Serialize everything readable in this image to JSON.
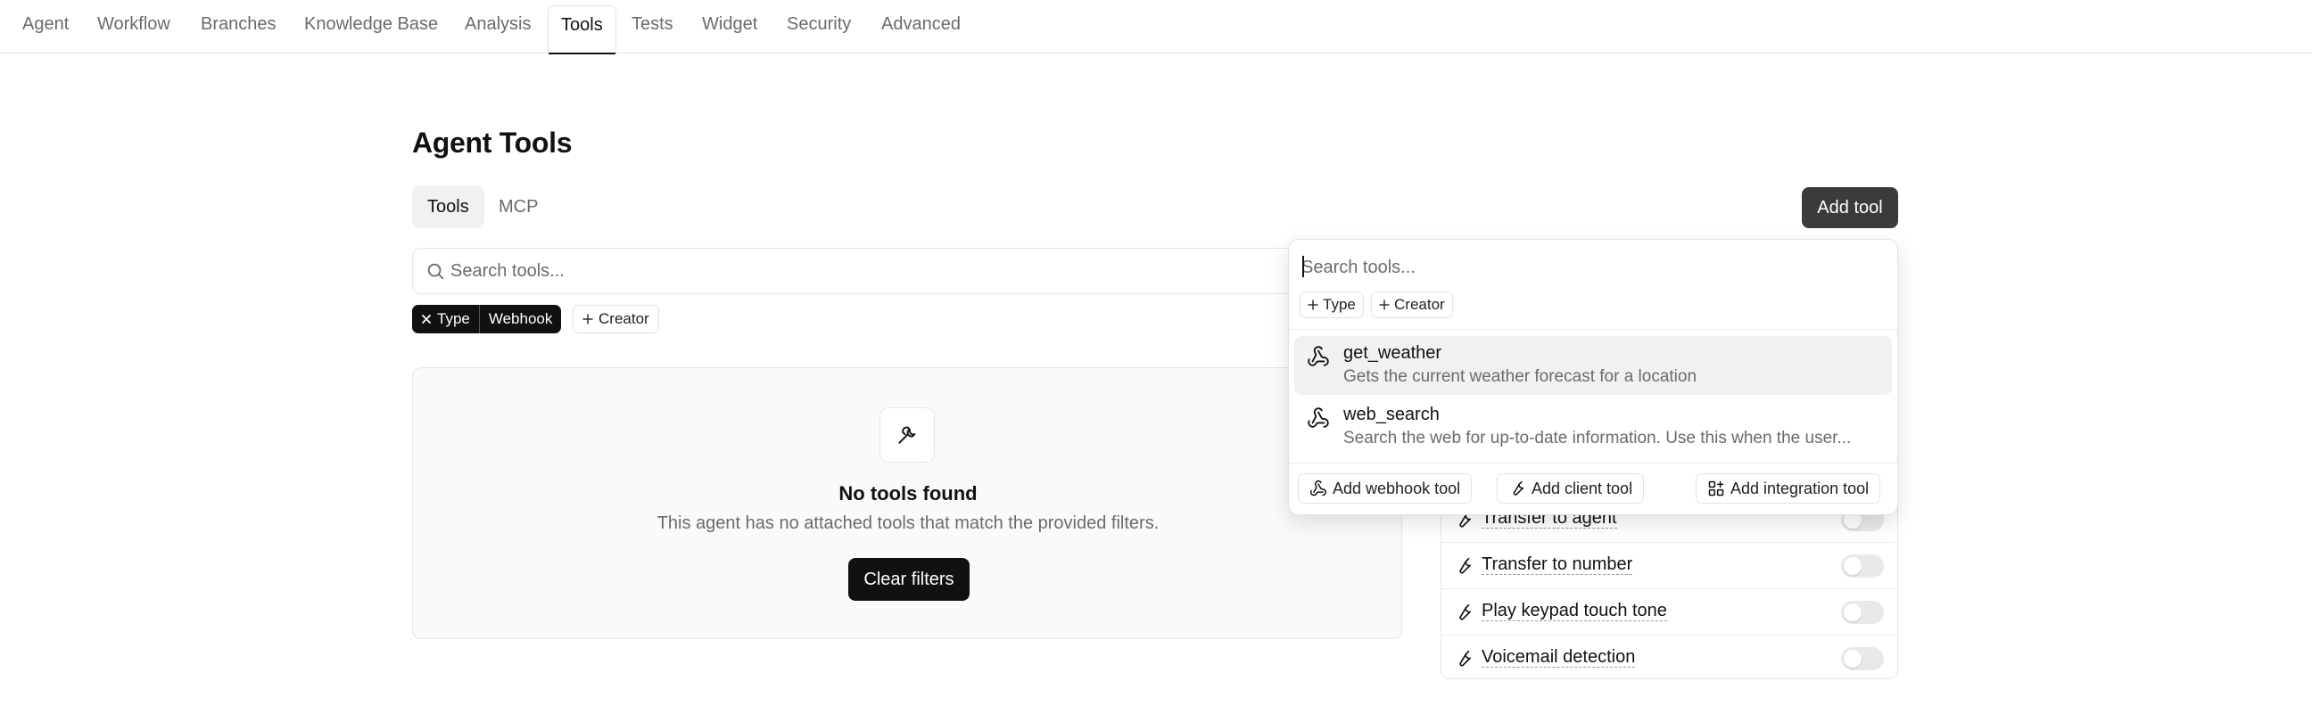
{
  "nav": {
    "tabs": [
      {
        "label": "Agent"
      },
      {
        "label": "Workflow"
      },
      {
        "label": "Branches"
      },
      {
        "label": "Knowledge Base"
      },
      {
        "label": "Analysis"
      },
      {
        "label": "Tools",
        "active": true
      },
      {
        "label": "Tests"
      },
      {
        "label": "Widget"
      },
      {
        "label": "Security"
      },
      {
        "label": "Advanced"
      }
    ]
  },
  "page": {
    "title": "Agent Tools",
    "subtabs": [
      {
        "label": "Tools",
        "active": true
      },
      {
        "label": "MCP"
      }
    ],
    "add_tool_label": "Add tool"
  },
  "search": {
    "placeholder": "Search tools..."
  },
  "filters": {
    "active": {
      "remove_icon": "close-icon",
      "key": "Type",
      "value": "Webhook"
    },
    "add_creator": "Creator",
    "add_icon": "plus-icon"
  },
  "empty_state": {
    "icon": "wrench-icon",
    "title": "No tools found",
    "description": "This agent has no attached tools that match the provided filters.",
    "clear_label": "Clear filters"
  },
  "system_tools": [
    {
      "label": "Transfer to agent",
      "enabled": false
    },
    {
      "label": "Transfer to number",
      "enabled": false
    },
    {
      "label": "Play keypad touch tone",
      "enabled": false
    },
    {
      "label": "Voicemail detection",
      "enabled": false
    }
  ],
  "dropdown": {
    "search_placeholder": "Search tools...",
    "chips": [
      "Type",
      "Creator"
    ],
    "items": [
      {
        "name": "get_weather",
        "description": "Gets the current weather forecast for a location",
        "icon": "webhook-icon"
      },
      {
        "name": "web_search",
        "description": "Search the web for up-to-date information. Use this when the user...",
        "icon": "webhook-icon"
      }
    ],
    "actions": [
      {
        "label": "Add webhook tool",
        "icon": "webhook-icon"
      },
      {
        "label": "Add client tool",
        "icon": "wrench-icon"
      },
      {
        "label": "Add integration tool",
        "icon": "integration-icon"
      }
    ]
  },
  "colors": {
    "accent_dark": "#111111",
    "add_tool_bg": "#3b3b3d",
    "muted_text": "#6b6b6b",
    "border": "#e6e6e6"
  }
}
